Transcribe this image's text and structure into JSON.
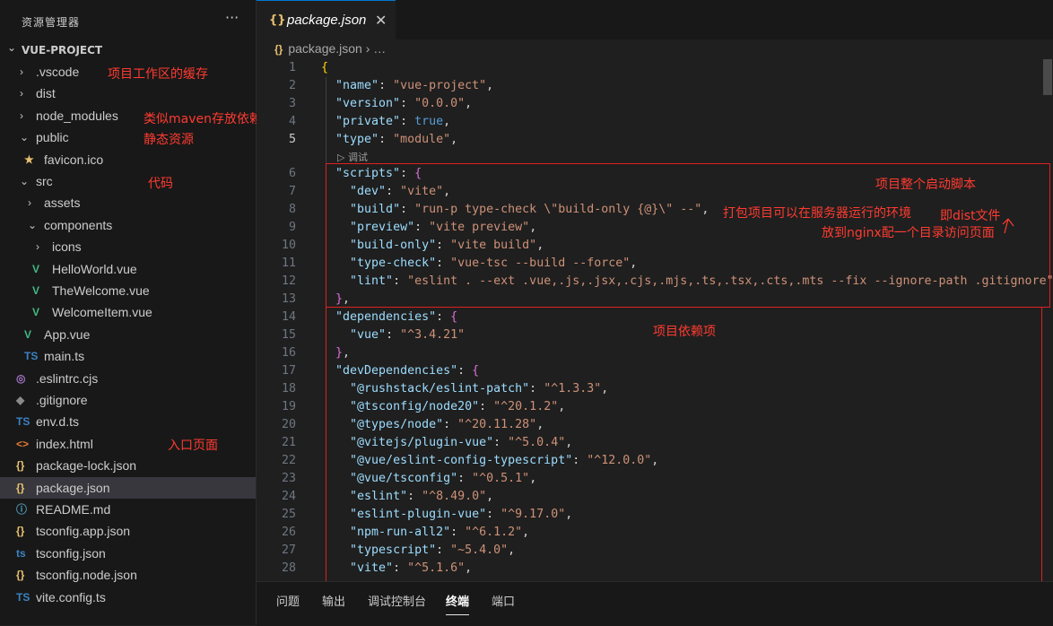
{
  "sidebar": {
    "title": "资源管理器",
    "more": "···",
    "project": "VUE-PROJECT",
    "items": [
      {
        "label": ".vscode",
        "chevron": "›",
        "icon": ""
      },
      {
        "label": "dist",
        "chevron": "›",
        "icon": ""
      },
      {
        "label": "node_modules",
        "chevron": "›",
        "icon": ""
      },
      {
        "label": "public",
        "chevron": "⌄",
        "icon": ""
      },
      {
        "label": "favicon.ico",
        "chevron": "",
        "icon": "★"
      },
      {
        "label": "src",
        "chevron": "⌄",
        "icon": ""
      },
      {
        "label": "assets",
        "chevron": "›",
        "icon": ""
      },
      {
        "label": "components",
        "chevron": "⌄",
        "icon": ""
      },
      {
        "label": "icons",
        "chevron": "›",
        "icon": ""
      },
      {
        "label": "HelloWorld.vue",
        "chevron": "",
        "icon": "V"
      },
      {
        "label": "TheWelcome.vue",
        "chevron": "",
        "icon": "V"
      },
      {
        "label": "WelcomeItem.vue",
        "chevron": "",
        "icon": "V"
      },
      {
        "label": "App.vue",
        "chevron": "",
        "icon": "V"
      },
      {
        "label": "main.ts",
        "chevron": "",
        "icon": "TS"
      },
      {
        "label": ".eslintrc.cjs",
        "chevron": "",
        "icon": "◎"
      },
      {
        "label": ".gitignore",
        "chevron": "",
        "icon": "◆"
      },
      {
        "label": "env.d.ts",
        "chevron": "",
        "icon": "TS"
      },
      {
        "label": "index.html",
        "chevron": "",
        "icon": "<>"
      },
      {
        "label": "package-lock.json",
        "chevron": "",
        "icon": "{}"
      },
      {
        "label": "package.json",
        "chevron": "",
        "icon": "{}"
      },
      {
        "label": "README.md",
        "chevron": "",
        "icon": "ⓘ"
      },
      {
        "label": "tsconfig.app.json",
        "chevron": "",
        "icon": "{}"
      },
      {
        "label": "tsconfig.json",
        "chevron": "",
        "icon": "ts"
      },
      {
        "label": "tsconfig.node.json",
        "chevron": "",
        "icon": "{}"
      },
      {
        "label": "vite.config.ts",
        "chevron": "",
        "icon": "TS"
      }
    ],
    "selected_item": "package.json",
    "annotations": {
      "vscode_note": "项目工作区的缓存",
      "node_modules_note": "类似maven存放依赖项",
      "public_note": "静态资源",
      "src_note": "代码",
      "index_note": "入口页面"
    }
  },
  "editor": {
    "tab_icon": "{}",
    "tab_label": "package.json",
    "tab_close": "✕",
    "breadcrumb_file": "package.json",
    "breadcrumb_rest": "› …",
    "active_line": 5,
    "codelens": "▷ 调试",
    "lines": [
      {
        "n": "1"
      },
      {
        "n": "2"
      },
      {
        "n": "3"
      },
      {
        "n": "4"
      },
      {
        "n": "5"
      },
      {
        "n": "6"
      },
      {
        "n": "7"
      },
      {
        "n": "8"
      },
      {
        "n": "9"
      },
      {
        "n": "10"
      },
      {
        "n": "11"
      },
      {
        "n": "12"
      },
      {
        "n": "13"
      },
      {
        "n": "14"
      },
      {
        "n": "15"
      },
      {
        "n": "16"
      },
      {
        "n": "17"
      },
      {
        "n": "18"
      },
      {
        "n": "19"
      },
      {
        "n": "20"
      },
      {
        "n": "21"
      },
      {
        "n": "22"
      },
      {
        "n": "23"
      },
      {
        "n": "24"
      },
      {
        "n": "25"
      },
      {
        "n": "26"
      },
      {
        "n": "27"
      },
      {
        "n": "28"
      }
    ],
    "code": {
      "l1": "{",
      "name_k": "\"name\"",
      "name_v": "\"vue-project\"",
      "version_k": "\"version\"",
      "version_v": "\"0.0.0\"",
      "private_k": "\"private\"",
      "private_v": "true",
      "type_k": "\"type\"",
      "type_v": "\"module\"",
      "scripts_k": "\"scripts\"",
      "dev_k": "\"dev\"",
      "dev_v": "\"vite\"",
      "build_k": "\"build\"",
      "build_v": "\"run-p type-check \\\"build-only {@}\\\" --\"",
      "preview_k": "\"preview\"",
      "preview_v": "\"vite preview\"",
      "buildonly_k": "\"build-only\"",
      "buildonly_v": "\"vite build\"",
      "typecheck_k": "\"type-check\"",
      "typecheck_v": "\"vue-tsc --build --force\"",
      "lint_k": "\"lint\"",
      "lint_v": "\"eslint . --ext .vue,.js,.jsx,.cjs,.mjs,.ts,.tsx,.cts,.mts --fix --ignore-path .gitignore\"",
      "deps_k": "\"dependencies\"",
      "vue_k": "\"vue\"",
      "vue_v": "\"^3.4.21\"",
      "devdeps_k": "\"devDependencies\"",
      "d1_k": "\"@rushstack/eslint-patch\"",
      "d1_v": "\"^1.3.3\"",
      "d2_k": "\"@tsconfig/node20\"",
      "d2_v": "\"^20.1.2\"",
      "d3_k": "\"@types/node\"",
      "d3_v": "\"^20.11.28\"",
      "d4_k": "\"@vitejs/plugin-vue\"",
      "d4_v": "\"^5.0.4\"",
      "d5_k": "\"@vue/eslint-config-typescript\"",
      "d5_v": "\"^12.0.0\"",
      "d6_k": "\"@vue/tsconfig\"",
      "d6_v": "\"^0.5.1\"",
      "d7_k": "\"eslint\"",
      "d7_v": "\"^8.49.0\"",
      "d8_k": "\"eslint-plugin-vue\"",
      "d8_v": "\"^9.17.0\"",
      "d9_k": "\"npm-run-all2\"",
      "d9_v": "\"^6.1.2\"",
      "d10_k": "\"typescript\"",
      "d10_v": "\"~5.4.0\"",
      "d11_k": "\"vite\"",
      "d11_v": "\"^5.1.6\""
    },
    "annotations": {
      "scripts_note": "项目整个启动脚本",
      "build_note": "打包项目可以在服务器运行的环境",
      "dist_note": "即dist文件",
      "nginx_note": "放到nginx配一个目录访问页面",
      "deps_note": "项目依赖项"
    }
  },
  "panel": {
    "tabs": [
      "问题",
      "输出",
      "调试控制台",
      "终端",
      "端口"
    ],
    "active": "终端"
  },
  "colors": {
    "annotation": "#ff3b30",
    "accent": "#0078d4",
    "vue_icon": "#42b883",
    "json_icon": "#e8c170",
    "ts_icon": "#3b82c4"
  }
}
